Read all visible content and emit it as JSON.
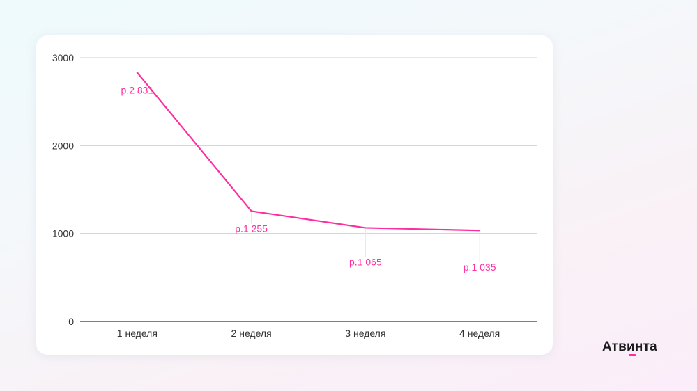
{
  "chart_data": {
    "type": "line",
    "categories": [
      "1 неделя",
      "2 неделя",
      "3 неделя",
      "4 неделя"
    ],
    "series": [
      {
        "values": [
          2831,
          1255,
          1065,
          1035
        ],
        "labels": [
          "р.2 831",
          "р.1 255",
          "р.1 065",
          "р.1 035"
        ]
      }
    ],
    "ylim": [
      0,
      3000
    ],
    "yticks": [
      0,
      1000,
      2000,
      3000
    ],
    "grid": true,
    "line_color": "#ff2da0"
  },
  "brand": {
    "name": "Атвинта",
    "accent": "#ff2da0"
  }
}
